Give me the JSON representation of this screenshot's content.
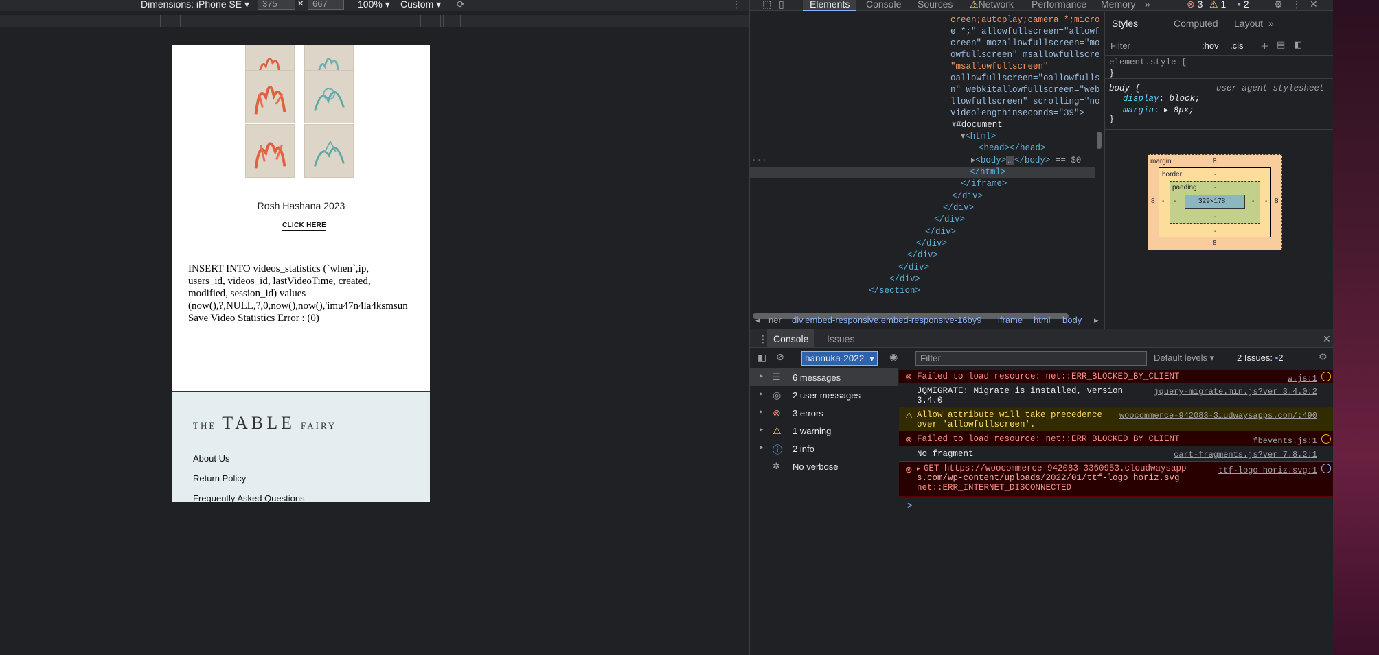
{
  "device_toolbar": {
    "dimensions_label": "Dimensions: iPhone SE",
    "width": "375",
    "height": "667",
    "zoom": "100%",
    "throttle": "Custom",
    "times": "×"
  },
  "page": {
    "promo_title": "Rosh Hashana 2023",
    "promo_link": "CLICK HERE",
    "sql_error_lines": [
      "INSERT INTO videos_statistics (`when`,ip,",
      "users_id, videos_id, lastVideoTime, created,",
      "modified, session_id) values",
      "(now(),?,NULL,?,0,now(),now(),'imu47n4la4ksmsun",
      "Save Video Statistics Error : (0)"
    ],
    "footer": {
      "brand_the": "THE",
      "brand_table": "TABLE",
      "brand_fairy": "FAIRY",
      "links": [
        "About Us",
        "Return Policy",
        "Frequently Asked Questions"
      ]
    }
  },
  "devtools": {
    "tabs": [
      "Elements",
      "Console",
      "Sources",
      "Network",
      "Performance",
      "Memory"
    ],
    "more_tabs": "»",
    "error_count": "3",
    "warning_count": "1",
    "info_count": "2",
    "elements_lines": [
      "creen;autoplay;camera *;micro",
      "e *;\" allowfullscreen=\"allowf",
      "creen\" mozallowfullscreen=\"mo",
      "owfullscreen\" msallowfullscre",
      "\"msallowfullscreen\"",
      "oallowfullscreen=\"oallowfulls",
      "n\" webkitallowfullscreen=\"web",
      "llowfullscreen\" scrolling=\"no",
      "videolengthinseconds=\"39\">"
    ],
    "document_node": "#document",
    "html_open": "<html>",
    "head_node": "<head></head>",
    "body_node": "<body>",
    "body_ellipsis": "…",
    "body_close": "</body>",
    "body_selected_suffix": "== $0",
    "html_close": "</html>",
    "iframe_close": "</iframe>",
    "div_close": "</div>",
    "section_close": "</section>",
    "breadcrumbs": [
      "ner",
      "div.embed-responsive.embed-responsive-16by9",
      "iframe",
      "html",
      "body"
    ],
    "styles_tabs": [
      "Styles",
      "Computed",
      "Layout"
    ],
    "styles_filter_placeholder": "Filter",
    "hov": ":hov",
    "cls": ".cls",
    "element_style": "element.style {",
    "close_brace": "}",
    "body_rule": "body {",
    "user_agent": "user agent stylesheet",
    "display_prop": "display",
    "display_val": "block;",
    "margin_prop": "margin",
    "margin_val": "8px;",
    "box_model": {
      "margin_label": "margin",
      "margin": "8",
      "border_label": "border",
      "padding_label": "padding",
      "dash": "-",
      "content": "329×178"
    },
    "drawer_tabs": [
      "Console",
      "Issues"
    ],
    "context": "hannuka-2022",
    "filter_placeholder": "Filter",
    "default_levels": "Default levels",
    "issues_label": "2 Issues:",
    "issues_count": "2",
    "sidebar": [
      {
        "label": "6 messages",
        "icon": "list-icon"
      },
      {
        "label": "2 user messages",
        "icon": "user-icon"
      },
      {
        "label": "3 errors",
        "icon": "error-icon"
      },
      {
        "label": "1 warning",
        "icon": "warning-icon"
      },
      {
        "label": "2 info",
        "icon": "info-icon"
      },
      {
        "label": "No verbose",
        "icon": "bug-icon"
      }
    ],
    "messages": [
      {
        "type": "error",
        "text": "Failed to load resource: net::ERR_BLOCKED_BY_CLIENT",
        "src": "w.js:1"
      },
      {
        "type": "log",
        "text": "JQMIGRATE: Migrate is installed, version",
        "text2": "3.4.0",
        "src": "jquery-migrate.min.js?ver=3.4.0:2"
      },
      {
        "type": "warning",
        "text": "Allow attribute will take precedence",
        "text2": "over 'allowfullscreen'.",
        "src": "woocommerce-942083-3…udwaysapps.com/:490"
      },
      {
        "type": "error",
        "text": "Failed to load resource: net::ERR_BLOCKED_BY_CLIENT",
        "src": "fbevents.js:1"
      },
      {
        "type": "log",
        "text": "No fragment",
        "src": "cart-fragments.js?ver=7.8.2:1"
      },
      {
        "type": "error",
        "text": "GET https://woocommerce-942083-3360953.cloudwaysapp",
        "text2": "s.com/wp-content/uploads/2022/01/ttf-logo_horiz.svg",
        "text3": "net::ERR_INTERNET_DISCONNECTED",
        "src": "ttf-logo_horiz.svg:1"
      }
    ],
    "prompt": ">"
  },
  "colors": {
    "accent": "#8ab4f8",
    "error": "#f28b82",
    "warning": "#fdd663"
  }
}
